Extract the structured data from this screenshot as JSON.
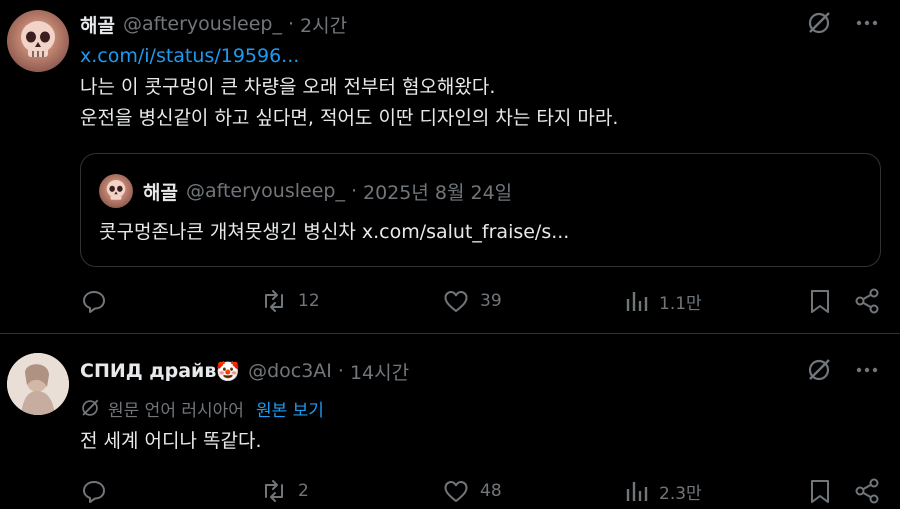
{
  "tweets": [
    {
      "name": "해골",
      "handle": "@afteryousleep_",
      "separator": "·",
      "time": "2시간",
      "link": "x.com/i/status/19596...",
      "lines": [
        "나는 이 콧구멍이 큰 차량을 오래 전부터 혐오해왔다.",
        "운전을 병신같이 하고 싶다면, 적어도 이딴 디자인의 차는 타지 마라."
      ],
      "quote": {
        "name": "해골",
        "handle": "@afteryousleep_",
        "separator": "·",
        "date": "2025년 8월 24일",
        "text_main": "콧구멍존나큰 개쳐못생긴 병신차 ",
        "text_link": "x.com/salut_fraise/s..."
      },
      "actions": {
        "replies": "",
        "reposts": "12",
        "likes": "39",
        "views": "1.1만"
      }
    },
    {
      "name": "СПИД драйв",
      "name_emoji": "🤡",
      "handle": "@doc3AI",
      "separator": "·",
      "time": "14시간",
      "translation": {
        "label": "원문 언어 러시아어",
        "link": "원본 보기"
      },
      "lines": [
        "전 세계 어디나 똑같다."
      ],
      "actions": {
        "replies": "",
        "reposts": "2",
        "likes": "48",
        "views": "2.3만"
      }
    }
  ],
  "icons": {
    "grok": "grok-icon",
    "more": "more-icon",
    "reply": "reply-icon",
    "repost": "repost-icon",
    "like": "like-icon",
    "views": "views-icon",
    "bookmark": "bookmark-icon",
    "share": "share-icon",
    "translate": "translate-icon"
  },
  "colors": {
    "background": "#000000",
    "text": "#e7e9ea",
    "muted": "#71767b",
    "link": "#1d9bf0",
    "border": "#2f3336"
  }
}
